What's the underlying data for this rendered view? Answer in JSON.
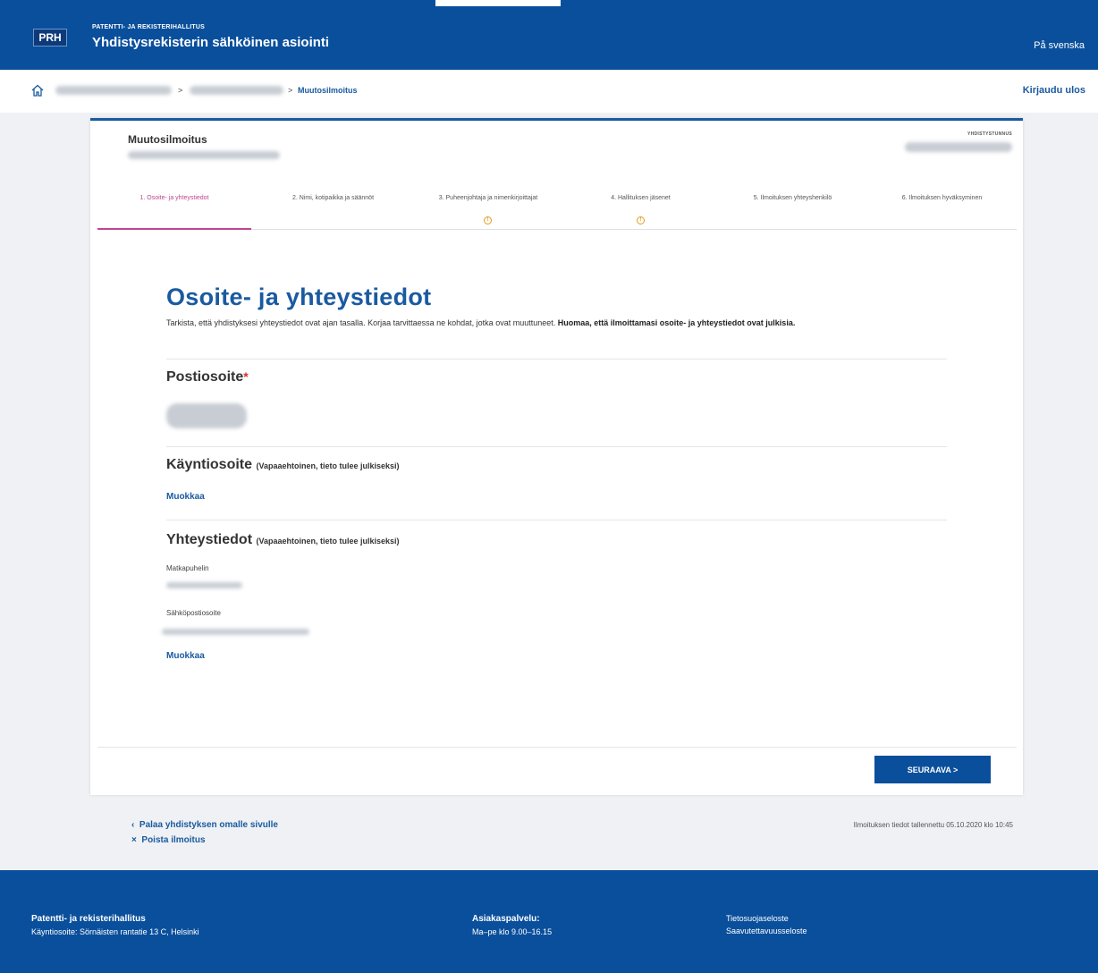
{
  "header": {
    "logo": "PRH",
    "org_name": "PATENTTI- JA REKISTERIHALLITUS",
    "app_title": "Yhdistysrekisterin sähköinen asiointi",
    "language_link": "På svenska"
  },
  "breadcrumb": {
    "separator_1": ">",
    "separator_2": ">",
    "current": "Muutosilmoitus",
    "logout": "Kirjaudu ulos"
  },
  "card": {
    "title": "Muutosilmoitus",
    "id_label": "YHDISTYSTUNNUS"
  },
  "steps": [
    {
      "label": "1. Osoite- ja yhteystiedot",
      "active": true,
      "warning": false
    },
    {
      "label": "2. Nimi, kotipaikka ja säännöt",
      "active": false,
      "warning": false
    },
    {
      "label": "3. Puheenjohtaja ja nimenkirjoittajat",
      "active": false,
      "warning": true
    },
    {
      "label": "4. Hallituksen jäsenet",
      "active": false,
      "warning": true
    },
    {
      "label": "5. Ilmoituksen yhteyshenkilö",
      "active": false,
      "warning": false
    },
    {
      "label": "6. Ilmoituksen hyväksyminen",
      "active": false,
      "warning": false
    }
  ],
  "main": {
    "heading": "Osoite- ja yhteystiedot",
    "intro_normal": "Tarkista, että yhdistyksesi yhteystiedot ovat ajan tasalla. Korjaa tarvittaessa ne kohdat, jotka ovat muuttuneet. ",
    "intro_bold": "Huomaa, että ilmoittamasi osoite- ja yhteystiedot ovat julkisia.",
    "postal": {
      "heading": "Postiosoite",
      "required_mark": "*"
    },
    "visiting": {
      "heading": "Käyntiosoite",
      "optional_note": "(Vapaaehtoinen, tieto tulee julkiseksi)",
      "edit_link": "Muokkaa"
    },
    "contact": {
      "heading": "Yhteystiedot",
      "optional_note": "(Vapaaehtoinen, tieto tulee julkiseksi)",
      "phone_label": "Matkapuhelin",
      "email_label": "Sähköpostiosoite",
      "edit_link": "Muokkaa"
    },
    "next_button": "SEURAAVA >"
  },
  "below": {
    "back_link": "Palaa yhdistyksen omalle sivulle",
    "back_icon": "‹",
    "delete_link": "Poista ilmoitus",
    "delete_icon": "×",
    "saved_text": "Ilmoituksen tiedot tallennettu 05.10.2020 klo 10:45"
  },
  "footer": {
    "org": "Patentti- ja rekisterihallitus",
    "address": "Käyntiosoite: Sörnäisten rantatie 13 C, Helsinki",
    "service_title": "Asiakaspalvelu:",
    "service_hours": "Ma–pe klo 9.00–16.15",
    "privacy": "Tietosuojaseloste",
    "accessibility": "Saavutettavuusseloste"
  },
  "colors": {
    "brand_blue": "#0a4f9c",
    "link_blue": "#1a5aa0",
    "active_step": "#c0458f",
    "required_red": "#d32f2f",
    "warning_orange": "#e59a1f"
  }
}
